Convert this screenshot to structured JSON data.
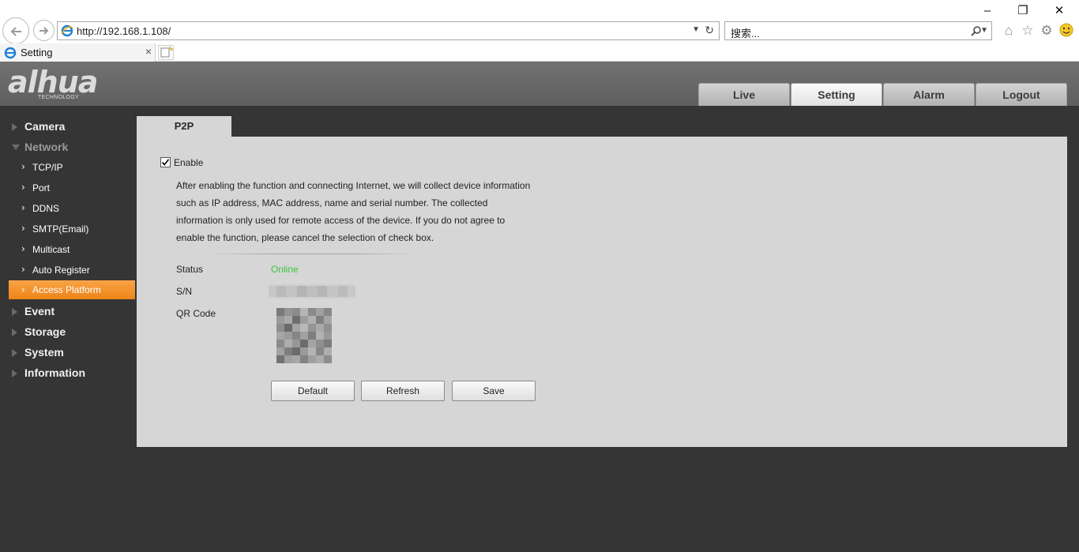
{
  "browser": {
    "url": "http://192.168.1.108/",
    "search_placeholder": "搜索...",
    "tab_title": "Setting"
  },
  "header": {
    "logo_text": "alhua",
    "logo_sub": "TECHNOLOGY",
    "tabs": [
      {
        "label": "Live"
      },
      {
        "label": "Setting",
        "active": true
      },
      {
        "label": "Alarm"
      },
      {
        "label": "Logout"
      }
    ]
  },
  "sidebar": {
    "items": [
      {
        "label": "Camera",
        "level": "top"
      },
      {
        "label": "Network",
        "level": "top",
        "expanded": true
      },
      {
        "label": "TCP/IP",
        "level": "sub"
      },
      {
        "label": "Port",
        "level": "sub"
      },
      {
        "label": "DDNS",
        "level": "sub"
      },
      {
        "label": "SMTP(Email)",
        "level": "sub"
      },
      {
        "label": "Multicast",
        "level": "sub"
      },
      {
        "label": "Auto Register",
        "level": "sub"
      },
      {
        "label": "Access Platform",
        "level": "sub",
        "active": true
      },
      {
        "label": "Event",
        "level": "top"
      },
      {
        "label": "Storage",
        "level": "top"
      },
      {
        "label": "System",
        "level": "top"
      },
      {
        "label": "Information",
        "level": "top"
      }
    ]
  },
  "content": {
    "tab_label": "P2P",
    "enable_label": "Enable",
    "enable_checked": true,
    "notice_lines": [
      "After enabling the function and connecting Internet, we will collect device information",
      "such as IP address, MAC address, name and serial number. The collected",
      "information is only used for remote access of the device. If you do not agree to",
      "enable the function, please cancel the selection of check box."
    ],
    "status_label": "Status",
    "status_value": "Online",
    "sn_label": "S/N",
    "qr_label": "QR Code",
    "buttons": {
      "default": "Default",
      "refresh": "Refresh",
      "save": "Save"
    }
  },
  "colors": {
    "accent": "#f39124",
    "status_online": "#3fc43f",
    "panel_bg": "#d6d6d6",
    "page_bg": "#353535"
  }
}
